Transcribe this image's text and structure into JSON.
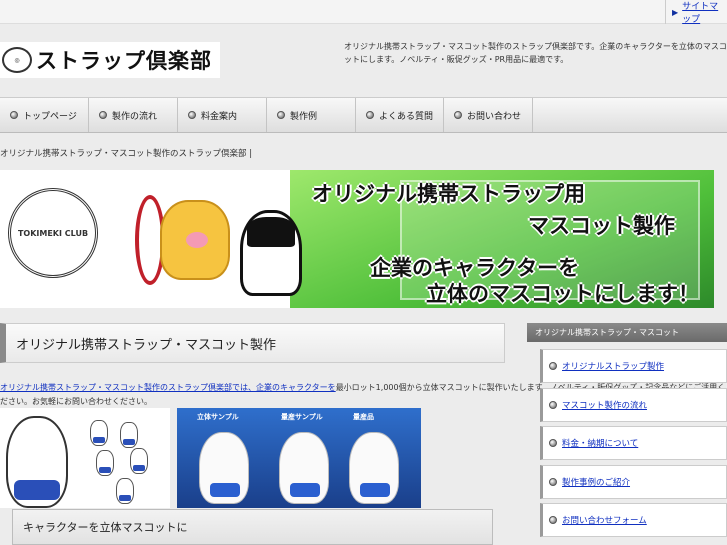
{
  "topbar": {
    "link_label": "サイトマップ"
  },
  "header": {
    "logo_text": "ストラップ倶楽部",
    "description": "オリジナル携帯ストラップ・マスコット製作のストラップ倶楽部です。企業のキャラクターを立体のマスコットにします。ノベルティ・販促グッズ・PR用品に最適です。"
  },
  "nav": {
    "items": [
      {
        "label": "トップページ"
      },
      {
        "label": "製作の流れ"
      },
      {
        "label": "料金案内"
      },
      {
        "label": "製作例"
      },
      {
        "label": "よくある質問"
      },
      {
        "label": "お問い合わせ"
      }
    ]
  },
  "breadcrumb": "オリジナル携帯ストラップ・マスコット製作のストラップ倶楽部 |",
  "hero": {
    "logo_text": "TOKIMEKI CLUB",
    "line1": "オリジナル携帯ストラップ用",
    "line2": "マスコット製作",
    "line3": "企業のキャラクターを",
    "line4": "立体のマスコットにします！"
  },
  "main": {
    "heading": "オリジナル携帯ストラップ・マスコット製作",
    "intro_link": "オリジナル携帯ストラップ・マスコット製作のストラップ倶楽部では、企業のキャラクターを",
    "intro_rest": "最小ロット1,000個から立体マスコットに製作いたします。ノベルティ・販促グッズ・記念品などにご活用ください。お気軽にお問い合わせください。",
    "sample_labels": [
      "立体サンプル",
      "量産サンプル",
      "量産品"
    ],
    "subheading": "キャラクターを立体マスコットに"
  },
  "sidebar": {
    "heading": "オリジナル携帯ストラップ・マスコット",
    "items": [
      {
        "label": "オリジナルストラップ製作"
      },
      {
        "label": "マスコット製作の流れ"
      },
      {
        "label": "料金・納期について"
      },
      {
        "label": "製作事例のご紹介"
      },
      {
        "label": "お問い合わせフォーム"
      }
    ]
  }
}
